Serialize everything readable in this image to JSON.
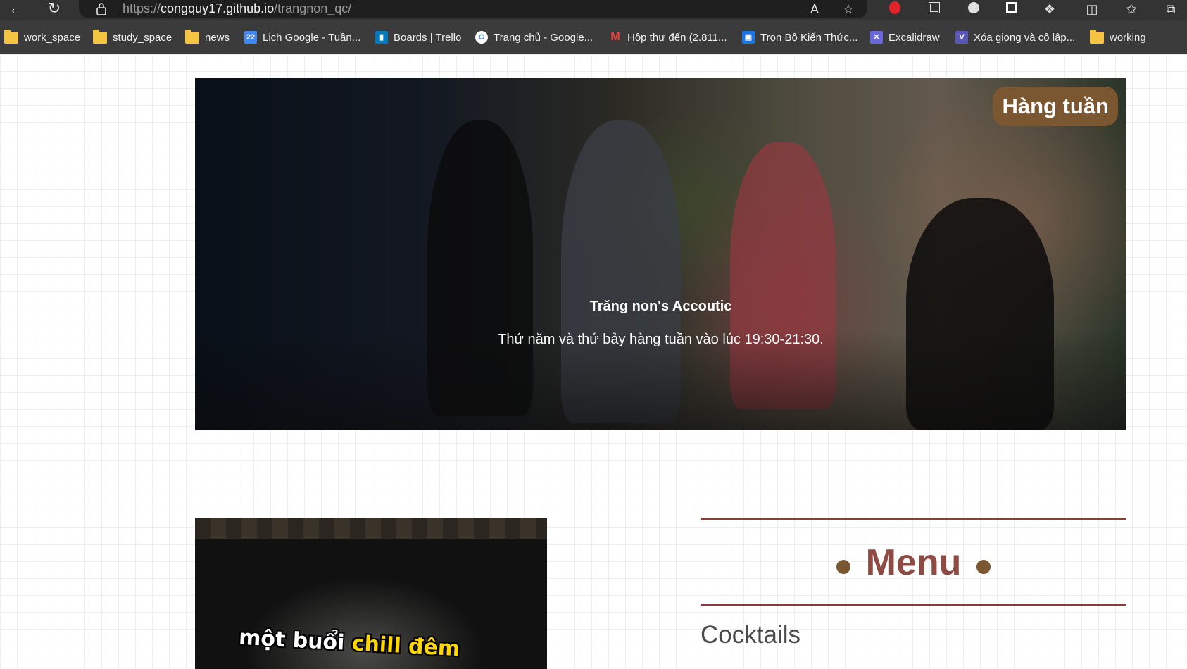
{
  "browser": {
    "url_scheme": "https://",
    "url_host": "congquy17.github.io",
    "url_path": "/trangnon_qc/",
    "bookmarks": [
      {
        "label": "work_space",
        "icon": "folder-icon"
      },
      {
        "label": "study_space",
        "icon": "folder-icon"
      },
      {
        "label": "news",
        "icon": "folder-icon"
      },
      {
        "label": "Lịch Google - Tuần...",
        "icon": "google-calendar-icon"
      },
      {
        "label": "Boards | Trello",
        "icon": "trello-icon"
      },
      {
        "label": "Trang chủ - Google...",
        "icon": "google-icon"
      },
      {
        "label": "Hộp thư đến (2.811...",
        "icon": "gmail-icon"
      },
      {
        "label": "Trọn Bộ Kiến Thức...",
        "icon": "site-icon"
      },
      {
        "label": "Excalidraw",
        "icon": "excalidraw-icon"
      },
      {
        "label": "Xóa giọng và cô lập...",
        "icon": "v-icon"
      },
      {
        "label": "working",
        "icon": "folder-icon"
      }
    ]
  },
  "hero": {
    "badge": "Hàng tuần",
    "title": "Trăng non's Accoutic",
    "subtitle": "Thứ năm và thứ bảy hàng tuần vào lúc 19:30-21:30."
  },
  "video": {
    "caption_part1": "một buổi ",
    "caption_highlight": "chill đêm"
  },
  "menu": {
    "title": "Menu",
    "first_category": "Cocktails"
  },
  "colors": {
    "accent_brown": "#7a5730",
    "menu_title": "#8e4b44",
    "rule": "#8c3b3b"
  }
}
